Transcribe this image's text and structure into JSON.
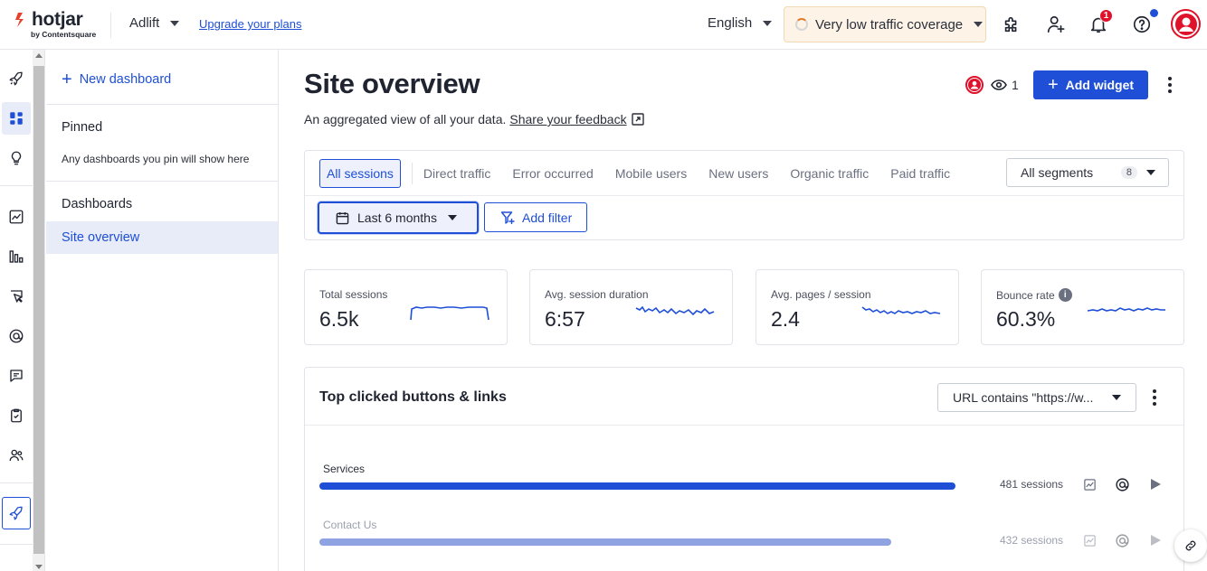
{
  "topbar": {
    "logo_text": "hotjar",
    "logo_sub": "by Contentsquare",
    "site_name": "Adlift",
    "upgrade_label": "Upgrade your plans",
    "language": "English",
    "coverage_label": "Very low traffic coverage",
    "notification_count": "1"
  },
  "sidebar": {
    "new_dashboard_label": "New dashboard",
    "pinned_heading": "Pinned",
    "pinned_note": "Any dashboards you pin will show here",
    "dashboards_heading": "Dashboards",
    "items": [
      {
        "label": "Site overview"
      }
    ]
  },
  "page": {
    "title": "Site overview",
    "subtitle": "An aggregated view of all your data.",
    "feedback_link": "Share your feedback",
    "viewer_count": "1",
    "add_widget_label": "Add widget"
  },
  "filters": {
    "segments": [
      {
        "label": "All sessions"
      },
      {
        "label": "Direct traffic"
      },
      {
        "label": "Error occurred"
      },
      {
        "label": "Mobile users"
      },
      {
        "label": "New users"
      },
      {
        "label": "Organic traffic"
      },
      {
        "label": "Paid traffic"
      }
    ],
    "all_segments_label": "All segments",
    "all_segments_count": "8",
    "date_range": "Last 6 months",
    "add_filter_label": "Add filter"
  },
  "metrics": [
    {
      "label": "Total sessions",
      "value": "6.5k"
    },
    {
      "label": "Avg. session duration",
      "value": "6:57"
    },
    {
      "label": "Avg. pages / session",
      "value": "2.4"
    },
    {
      "label": "Bounce rate",
      "value": "60.3%"
    }
  ],
  "widget": {
    "title": "Top clicked buttons & links",
    "url_filter": "URL contains \"https://w...",
    "rows": [
      {
        "label": "Services",
        "sessions": "481 sessions",
        "fill_fraction": 1.0,
        "color": "#1e4fd6"
      },
      {
        "label": "Contact Us",
        "sessions": "432 sessions",
        "fill_fraction": 0.899,
        "color": "#8fa3e3"
      }
    ]
  },
  "colors": {
    "brand_blue": "#1e4fd6",
    "accent_red": "#e0112b",
    "coverage_bg": "#fdf3e6"
  }
}
